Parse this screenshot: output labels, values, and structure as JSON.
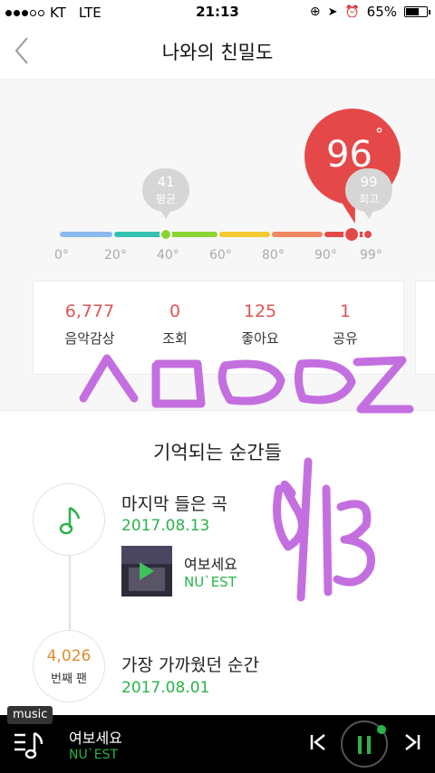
{
  "status_bar": {
    "carrier": "KT",
    "network": "LTE",
    "time": "21:13",
    "battery": "65%",
    "battery_level": 0.65
  },
  "header": {
    "title": "나와의 친밀도",
    "back_icon": "chevron-left-icon"
  },
  "scale": {
    "score": "96",
    "score_unit": "°",
    "average_value": "41",
    "average_label": "평균",
    "max_value": "99",
    "max_label": "최고",
    "ticks": [
      "0°",
      "20°",
      "40°",
      "60°",
      "80°",
      "90°",
      "99°"
    ],
    "colors": [
      "#8ab9ee",
      "#33c2b0",
      "#8cd432",
      "#f2c932",
      "#f08860",
      "#e24a4a"
    ]
  },
  "stats": [
    {
      "value": "6,777",
      "label": "음악감상"
    },
    {
      "value": "0",
      "label": "조회"
    },
    {
      "value": "125",
      "label": "좋아요"
    },
    {
      "value": "1",
      "label": "공유"
    }
  ],
  "moments": {
    "title": "기억되는 순간들",
    "items": [
      {
        "title": "마지막 들은 곡",
        "date": "2017.08.13",
        "track_title": "여보세요",
        "track_artist": "NU`EST"
      },
      {
        "fan_number": "4,026",
        "fan_label": "번째 팬",
        "title": "가장 가까웠던 순간",
        "date": "2017.08.01"
      }
    ]
  },
  "player": {
    "tag": "music",
    "title": "여보세요",
    "artist": "NU`EST"
  }
}
